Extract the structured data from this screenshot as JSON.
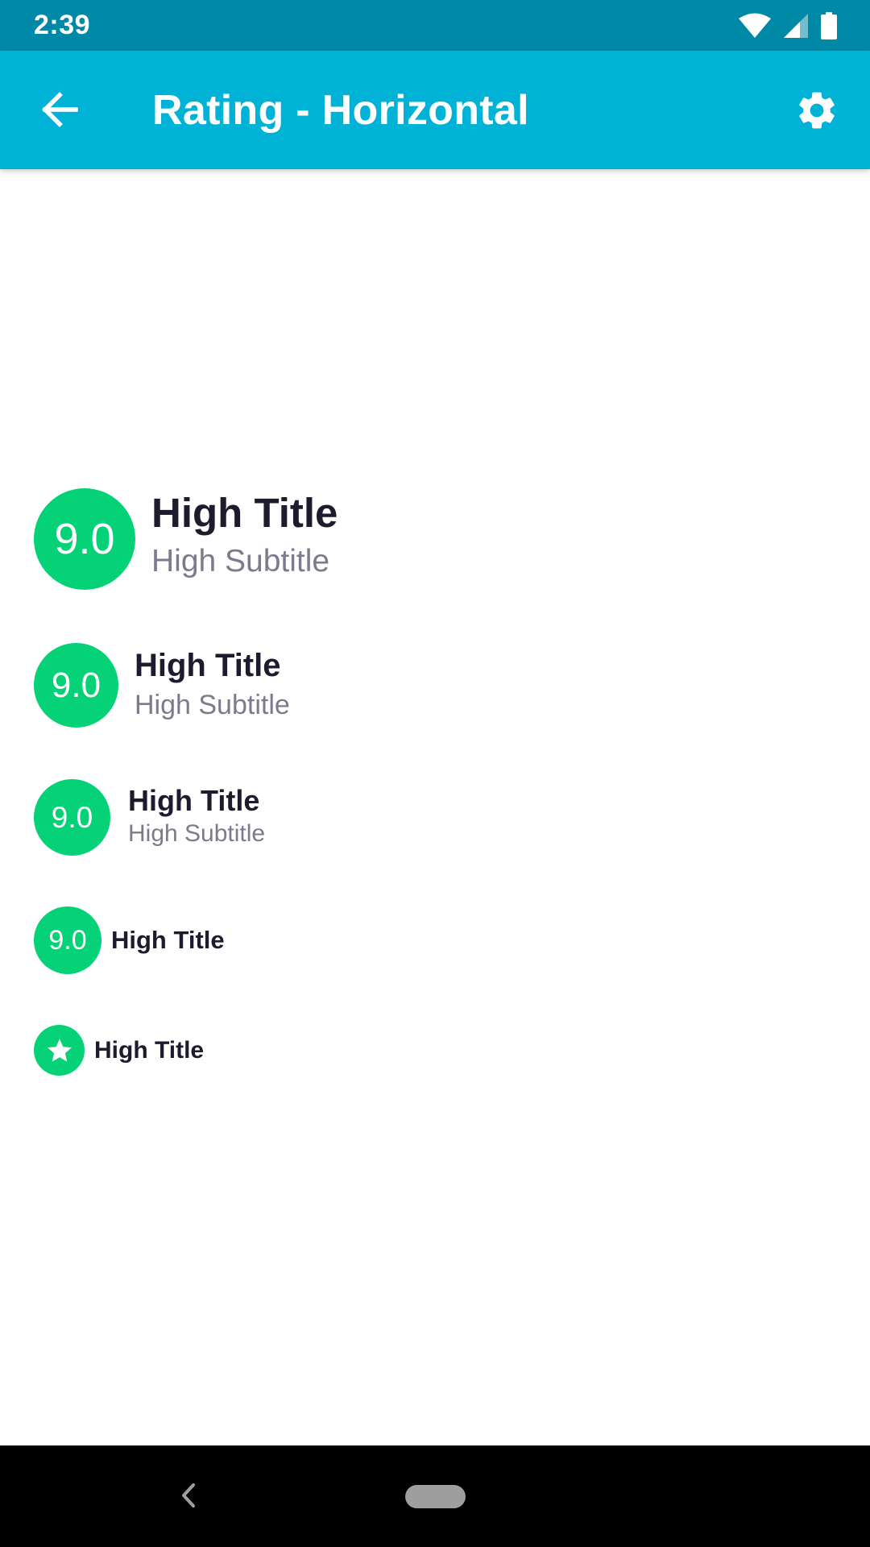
{
  "status_bar": {
    "time": "2:39",
    "icons": [
      "wifi-icon",
      "cell-signal-icon",
      "battery-icon"
    ]
  },
  "app_bar": {
    "title": "Rating - Horizontal",
    "back_icon": "arrow-back-icon",
    "settings_icon": "gear-icon"
  },
  "ratings": [
    {
      "score": "9.0",
      "title": "High Title",
      "subtitle": "High Subtitle"
    },
    {
      "score": "9.0",
      "title": "High Title",
      "subtitle": "High Subtitle"
    },
    {
      "score": "9.0",
      "title": "High Title",
      "subtitle": "High Subtitle"
    },
    {
      "score": "9.0",
      "title": "High Title"
    },
    {
      "icon": "star-icon",
      "title": "High Title"
    }
  ],
  "colors": {
    "status_bar": "#0089a7",
    "app_bar": "#00b2d6",
    "rating_badge": "#05d276",
    "title_text": "#1e1b2e",
    "subtitle_text": "#7c7a8c",
    "nav_bar": "#000000"
  },
  "nav_bar": {
    "icons": [
      "nav-back-icon",
      "nav-home-pill"
    ]
  }
}
